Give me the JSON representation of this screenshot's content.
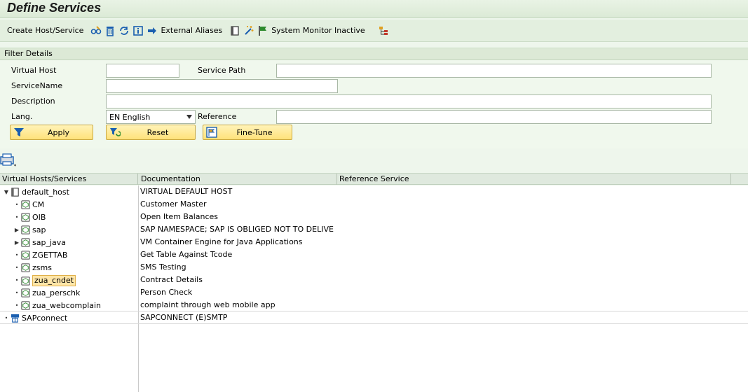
{
  "title": "Define Services",
  "toolbar": {
    "create_label": "Create Host/Service",
    "external_aliases_label": "External Aliases",
    "system_monitor_label": "System Monitor Inactive"
  },
  "filter": {
    "header": "Filter Details",
    "virtual_host_label": "Virtual Host",
    "virtual_host_value": "",
    "service_path_label": "Service Path",
    "service_path_value": "",
    "service_name_label": "ServiceName",
    "service_name_value": "",
    "description_label": "Description",
    "description_value": "",
    "lang_label": "Lang.",
    "lang_value": "EN English",
    "reference_label": "Reference",
    "reference_value": "",
    "apply_label": "Apply",
    "reset_label": "Reset",
    "finetune_label": "Fine-Tune"
  },
  "table": {
    "col_hosts": "Virtual Hosts/Services",
    "col_doc": "Documentation",
    "col_ref": "Reference Service",
    "rows": [
      {
        "name": "default_host",
        "doc": "VIRTUAL DEFAULT HOST"
      },
      {
        "name": "CM",
        "doc": "Customer Master"
      },
      {
        "name": "OIB",
        "doc": "Open Item Balances"
      },
      {
        "name": "sap",
        "doc": "SAP NAMESPACE; SAP IS OBLIGED NOT TO DELIVE"
      },
      {
        "name": "sap_java",
        "doc": "VM Container Engine for Java Applications"
      },
      {
        "name": "ZGETTAB",
        "doc": "Get Table Against Tcode"
      },
      {
        "name": "zsms",
        "doc": "SMS Testing"
      },
      {
        "name": "zua_cndet",
        "doc": "Contract Details"
      },
      {
        "name": "zua_perschk",
        "doc": "Person Check"
      },
      {
        "name": "zua_webcomplain",
        "doc": "complaint through web mobile app"
      },
      {
        "name": "SAPconnect",
        "doc": "SAPCONNECT (E)SMTP"
      }
    ]
  },
  "colors": {
    "accent_green": "#2e8b2e",
    "button_yellow": "#ffe27a",
    "selection": "#ffe6a8"
  }
}
